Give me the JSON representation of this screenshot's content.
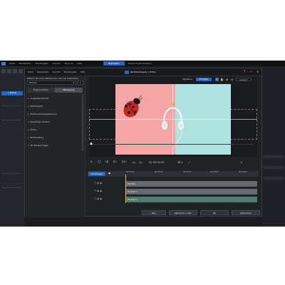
{
  "app": {
    "menu": [
      "Datei",
      "Bearbeiten",
      "Wiedergabe",
      "Ansicht",
      "Plug-ins",
      "Hilfe"
    ],
    "center_tab": "Bearbeiten",
    "project": "Neues Projekt (Kreativ)*",
    "left_button": "+ Medien"
  },
  "dialog": {
    "menu": [
      "Datei",
      "Bearbeiten",
      "Ansicht",
      "Wiedergabe",
      "Hilfe"
    ],
    "title": "Partikeldesigner | Editor",
    "window_controls": [
      "?",
      "─",
      "✕"
    ]
  },
  "left_panel": {
    "hint": "Wählen Sie einen Partikel aus, den Sie bearbeiten",
    "select_value": "Partikel",
    "tabs": [
      "Eigenschaften",
      "Bewegung"
    ],
    "active_tab": 1,
    "sections": [
      "Ausgabeintervall",
      "Partikelzahl",
      "Partikel-Anzeigeoptionen",
      "Parameter ändern",
      "Farbe",
      "Einblendung",
      "3D-Einstellungen"
    ]
  },
  "preview": {
    "mode_buttons": [
      "Objektive",
      "Einfügen"
    ],
    "active_mode": 1,
    "tools": [
      "cursor-icon",
      "hand-icon",
      "zoom-in-icon",
      "zoom-out-icon"
    ],
    "zoom_value": "Anpas",
    "colors": {
      "pink": "#f4a6a6",
      "cyan": "#aee3df",
      "ladybug": "#c62828",
      "headphone": "#f5f7f7"
    }
  },
  "transport": {
    "timecode": "00:00:00:00",
    "zoom": "3D",
    "buttons": [
      "play-icon",
      "stop-icon",
      "prev-frame-icon",
      "next-frame-icon",
      "fast-forward-icon",
      "prev-key-icon",
      "next-key-icon"
    ]
  },
  "timeline": {
    "add_label": "Hinzufügen",
    "ticks": [
      "00:00:00",
      "00:00:00",
      "00:00:03",
      "00:00:06",
      "00:00:09"
    ],
    "clips": [
      "Partikel",
      "Partikel 1",
      "Partikel 2"
    ]
  },
  "footer": {
    "buttons": [
      "Neu",
      "Speichern unter",
      "OK",
      "Abbrechen"
    ]
  }
}
